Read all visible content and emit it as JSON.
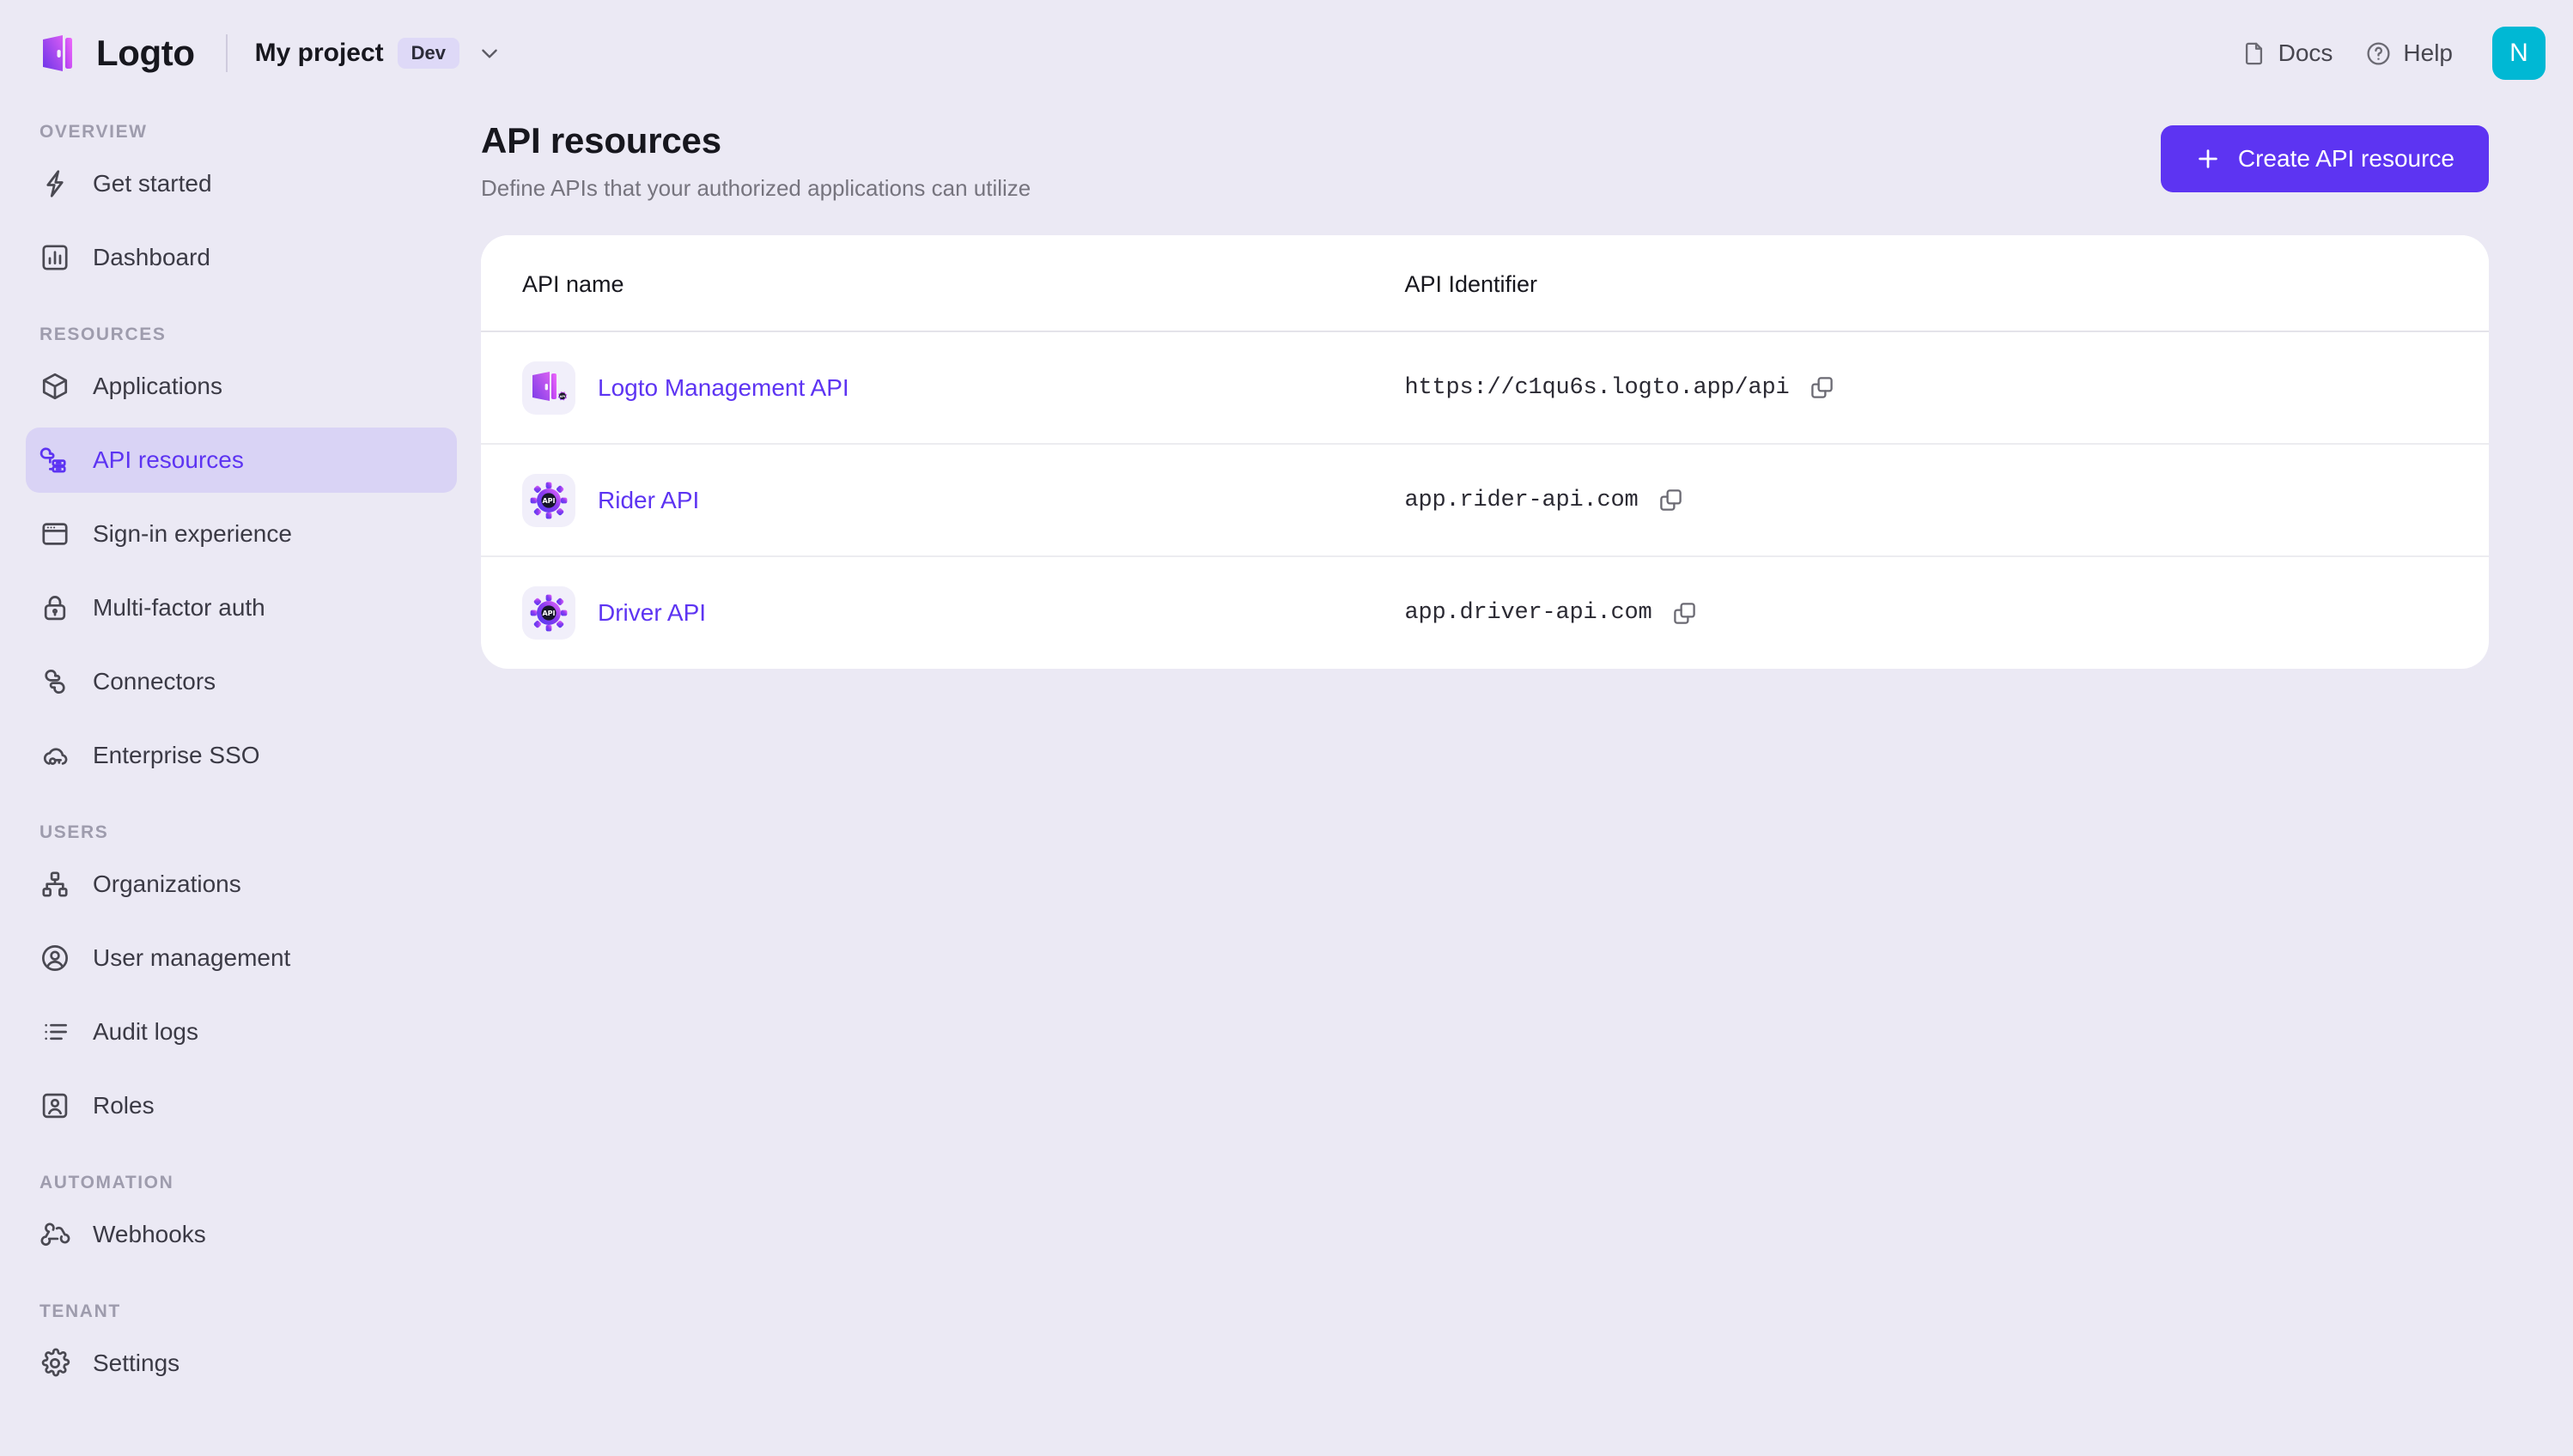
{
  "topbar": {
    "brand_name": "Logto",
    "project_name": "My project",
    "env_badge": "Dev",
    "docs_label": "Docs",
    "help_label": "Help",
    "avatar_initial": "N"
  },
  "sidebar": {
    "sections": [
      {
        "label": "Overview",
        "items": [
          {
            "label": "Get started",
            "icon": "bolt-icon",
            "active": false
          },
          {
            "label": "Dashboard",
            "icon": "chart-icon",
            "active": false
          }
        ]
      },
      {
        "label": "Resources",
        "items": [
          {
            "label": "Applications",
            "icon": "cube-icon",
            "active": false
          },
          {
            "label": "API resources",
            "icon": "api-resources-icon",
            "active": true
          },
          {
            "label": "Sign-in experience",
            "icon": "window-icon",
            "active": false
          },
          {
            "label": "Multi-factor auth",
            "icon": "lock-icon",
            "active": false
          },
          {
            "label": "Connectors",
            "icon": "connectors-icon",
            "active": false
          },
          {
            "label": "Enterprise SSO",
            "icon": "cloud-key-icon",
            "active": false
          }
        ]
      },
      {
        "label": "Users",
        "items": [
          {
            "label": "Organizations",
            "icon": "org-chart-icon",
            "active": false
          },
          {
            "label": "User management",
            "icon": "user-circle-icon",
            "active": false
          },
          {
            "label": "Audit logs",
            "icon": "list-icon",
            "active": false
          },
          {
            "label": "Roles",
            "icon": "roles-icon",
            "active": false
          }
        ]
      },
      {
        "label": "Automation",
        "items": [
          {
            "label": "Webhooks",
            "icon": "webhook-icon",
            "active": false
          }
        ]
      },
      {
        "label": "Tenant",
        "items": [
          {
            "label": "Settings",
            "icon": "gear-icon",
            "active": false
          }
        ]
      }
    ]
  },
  "main": {
    "title": "API resources",
    "subtitle": "Define APIs that your authorized applications can utilize",
    "create_button": "Create API resource",
    "table": {
      "columns": [
        "API name",
        "API Identifier"
      ],
      "rows": [
        {
          "name": "Logto Management API",
          "identifier": "https://c1qu6s.logto.app/api",
          "icon": "logto-management-api-icon"
        },
        {
          "name": "Rider API",
          "identifier": "app.rider-api.com",
          "icon": "api-gear-icon"
        },
        {
          "name": "Driver API",
          "identifier": "app.driver-api.com",
          "icon": "api-gear-icon"
        }
      ]
    }
  },
  "colors": {
    "accent": "#5d34f2",
    "page_bg": "#ebe9f4",
    "card_bg": "#ffffff",
    "active_nav_bg": "#d9d3f5",
    "avatar_bg": "#00b8d4",
    "badge_bg": "#ded9f7"
  }
}
